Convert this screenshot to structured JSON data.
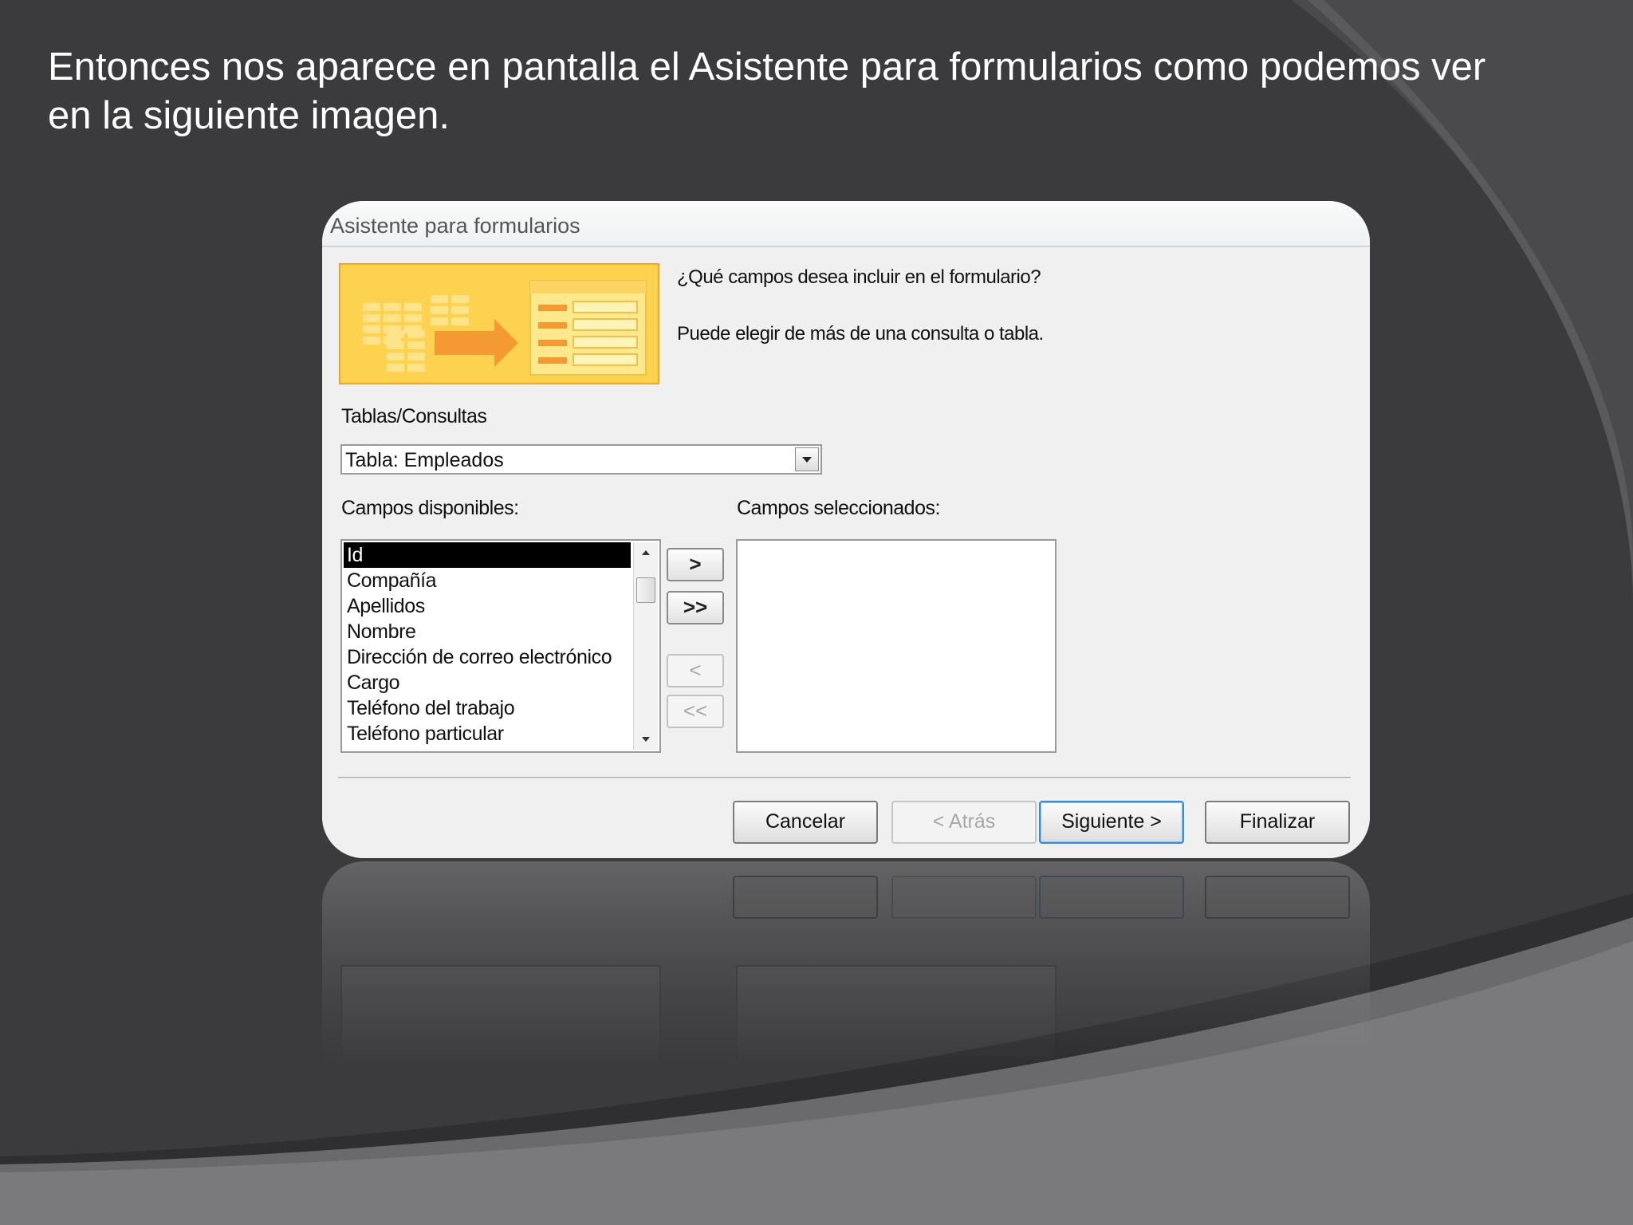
{
  "slide": {
    "caption": "Entonces nos aparece en pantalla el Asistente para formularios como podemos ver\nen la siguiente  imagen."
  },
  "dialog": {
    "title": "Asistente para formularios",
    "question": "¿Qué campos desea incluir en el formulario?",
    "hint": "Puede elegir de más de una consulta o tabla.",
    "tables_label": "Tablas/Consultas",
    "tables_value": "Tabla: Empleados",
    "available_label": "Campos disponibles:",
    "selected_label": "Campos seleccionados:",
    "available_fields": [
      "Id",
      "Compañía",
      "Apellidos",
      "Nombre",
      "Dirección de correo electrónico",
      "Cargo",
      "Teléfono del trabajo",
      "Teléfono particular"
    ],
    "selected_fields": [],
    "move_buttons": {
      "add": ">",
      "add_all": ">>",
      "remove": "<",
      "remove_all": "<<"
    },
    "footer": {
      "cancel": "Cancelar",
      "back": "< Atrás",
      "next": "Siguiente >",
      "finish": "Finalizar"
    }
  },
  "colors": {
    "background": "#3a3a3c",
    "illustration_orange": "#f7b32b",
    "default_button_border": "#3a8ed8",
    "selection": "#000000"
  }
}
